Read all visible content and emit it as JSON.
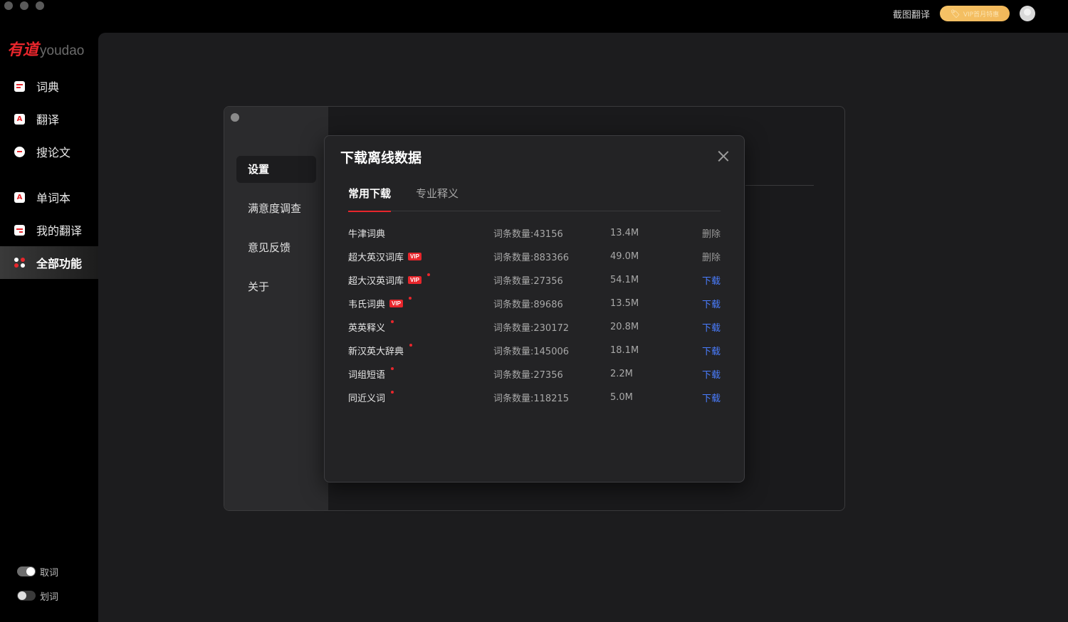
{
  "topbar": {
    "screenshot_translate": "截图翻译",
    "vip_pill": "VIP首月特惠",
    "vip_icon": "🏷"
  },
  "logo": {
    "cn": "有道",
    "en": "youdao"
  },
  "sidebar": {
    "items": [
      {
        "label": "词典",
        "icon": "dictionary-icon"
      },
      {
        "label": "翻译",
        "icon": "translate-icon"
      },
      {
        "label": "搜论文",
        "icon": "paper-search-icon"
      },
      {
        "label": "单词本",
        "icon": "wordbook-icon"
      },
      {
        "label": "我的翻译",
        "icon": "my-translation-icon"
      },
      {
        "label": "全部功能",
        "icon": "all-features-icon",
        "active": true
      }
    ],
    "toggles": [
      {
        "label": "取词",
        "on": true
      },
      {
        "label": "划词",
        "on": false
      }
    ]
  },
  "settings": {
    "menu": [
      {
        "label": "设置",
        "active": true
      },
      {
        "label": "满意度调查"
      },
      {
        "label": "意见反馈"
      },
      {
        "label": "关于"
      }
    ]
  },
  "modal": {
    "title": "下载离线数据",
    "tabs": [
      {
        "label": "常用下载",
        "active": true
      },
      {
        "label": "专业释义"
      }
    ],
    "count_prefix": "词条数量:",
    "vip_tag": "VIP",
    "rows": [
      {
        "name": "牛津词典",
        "vip": false,
        "dot": false,
        "count": "43156",
        "size": "13.4M",
        "action": "删除",
        "action_type": "delete"
      },
      {
        "name": "超大英汉词库",
        "vip": true,
        "dot": false,
        "count": "883366",
        "size": "49.0M",
        "action": "删除",
        "action_type": "delete"
      },
      {
        "name": "超大汉英词库",
        "vip": true,
        "dot": true,
        "count": "27356",
        "size": "54.1M",
        "action": "下载",
        "action_type": "download"
      },
      {
        "name": "韦氏词典",
        "vip": true,
        "dot": true,
        "count": "89686",
        "size": "13.5M",
        "action": "下载",
        "action_type": "download"
      },
      {
        "name": "英英释义",
        "vip": false,
        "dot": true,
        "count": "230172",
        "size": "20.8M",
        "action": "下载",
        "action_type": "download"
      },
      {
        "name": "新汉英大辞典",
        "vip": false,
        "dot": true,
        "count": "145006",
        "size": "18.1M",
        "action": "下载",
        "action_type": "download"
      },
      {
        "name": "词组短语",
        "vip": false,
        "dot": true,
        "count": "27356",
        "size": "2.2M",
        "action": "下载",
        "action_type": "download"
      },
      {
        "name": "同近义词",
        "vip": false,
        "dot": true,
        "count": "118215",
        "size": "5.0M",
        "action": "下载",
        "action_type": "download"
      }
    ]
  },
  "colors": {
    "accent_red": "#e8262c",
    "link_blue": "#4a7dff",
    "vip_gold": "#f5c266"
  }
}
